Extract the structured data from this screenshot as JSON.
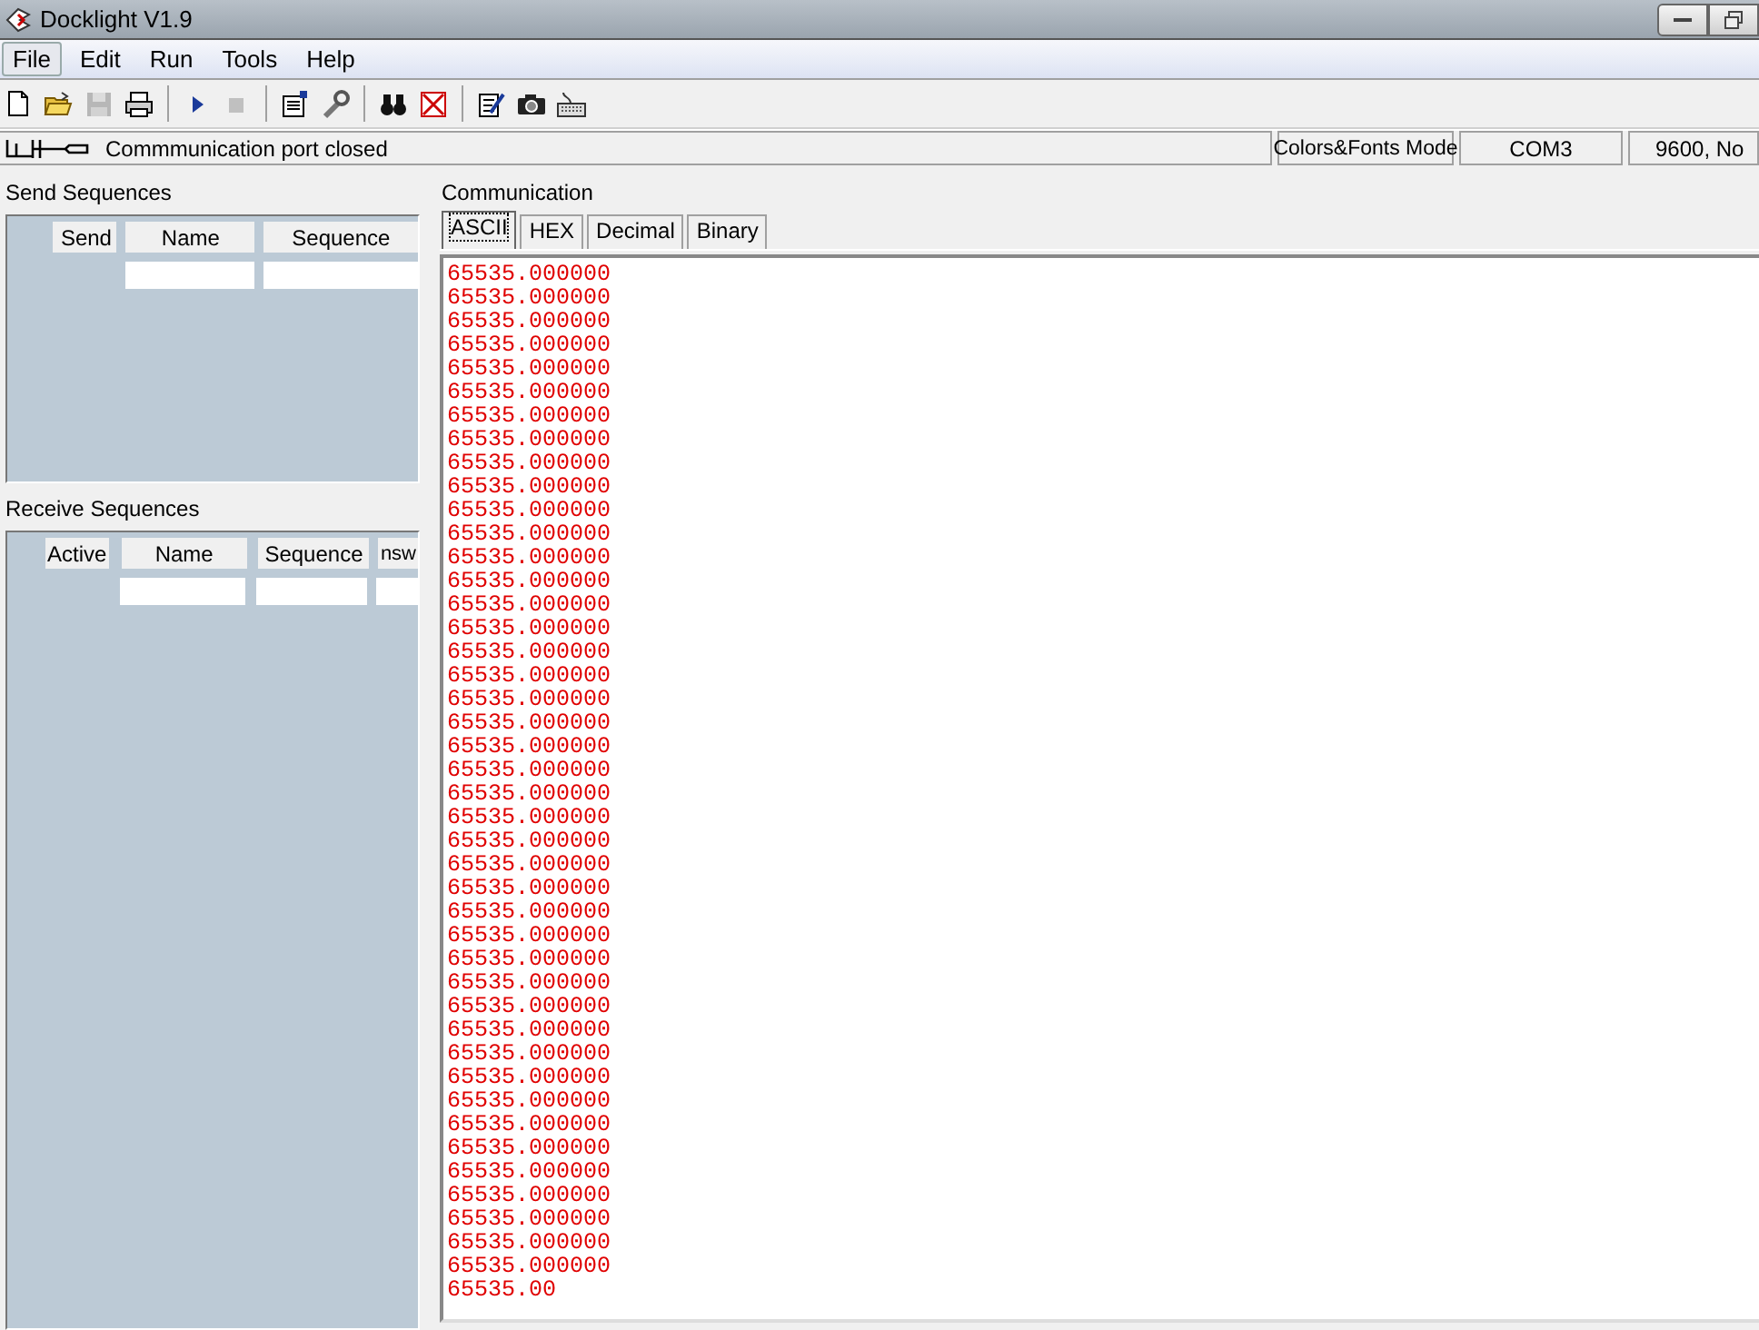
{
  "window": {
    "title": "Docklight V1.9"
  },
  "menu": [
    {
      "label": "File",
      "selected": true
    },
    {
      "label": "Edit",
      "selected": false
    },
    {
      "label": "Run",
      "selected": false
    },
    {
      "label": "Tools",
      "selected": false
    },
    {
      "label": "Help",
      "selected": false
    }
  ],
  "toolbar": [
    {
      "kind": "new"
    },
    {
      "kind": "open"
    },
    {
      "kind": "save",
      "disabled": true
    },
    {
      "kind": "print"
    },
    {
      "kind": "sep"
    },
    {
      "kind": "play"
    },
    {
      "kind": "stop",
      "disabled": true
    },
    {
      "kind": "sep"
    },
    {
      "kind": "props"
    },
    {
      "kind": "wrench"
    },
    {
      "kind": "sep"
    },
    {
      "kind": "find"
    },
    {
      "kind": "clear"
    },
    {
      "kind": "sep"
    },
    {
      "kind": "edit"
    },
    {
      "kind": "camera"
    },
    {
      "kind": "keyboard"
    }
  ],
  "status_bar": {
    "message": "Commmunication port closed",
    "panes": [
      "Colors&Fonts Mode",
      "COM3",
      "9600, No"
    ]
  },
  "send_sequences": {
    "title": "Send Sequences",
    "columns": [
      "Send",
      "Name",
      "Sequence"
    ]
  },
  "receive_sequences": {
    "title": "Receive Sequences",
    "columns": [
      "Active",
      "Name",
      "Sequence",
      "nsw"
    ]
  },
  "communication": {
    "title": "Communication",
    "tabs": [
      {
        "label": "ASCII",
        "selected": true
      },
      {
        "label": "HEX",
        "selected": false
      },
      {
        "label": "Decimal",
        "selected": false
      },
      {
        "label": "Binary",
        "selected": false
      }
    ],
    "lines": [
      "65535.000000",
      "65535.000000",
      "65535.000000",
      "65535.000000",
      "65535.000000",
      "65535.000000",
      "65535.000000",
      "65535.000000",
      "65535.000000",
      "65535.000000",
      "65535.000000",
      "65535.000000",
      "65535.000000",
      "65535.000000",
      "65535.000000",
      "65535.000000",
      "65535.000000",
      "65535.000000",
      "65535.000000",
      "65535.000000",
      "65535.000000",
      "65535.000000",
      "65535.000000",
      "65535.000000",
      "65535.000000",
      "65535.000000",
      "65535.000000",
      "65535.000000",
      "65535.000000",
      "65535.000000",
      "65535.000000",
      "65535.000000",
      "65535.000000",
      "65535.000000",
      "65535.000000",
      "65535.000000",
      "65535.000000",
      "65535.000000",
      "65535.000000",
      "65535.000000",
      "65535.000000",
      "65535.000000",
      "65535.000000",
      "65535.00"
    ]
  }
}
